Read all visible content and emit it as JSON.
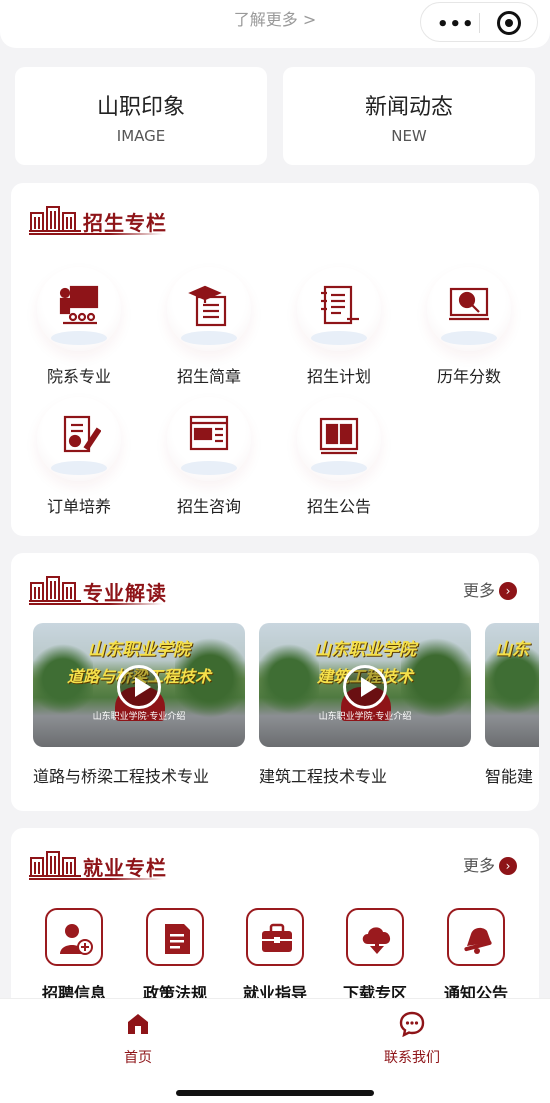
{
  "top": {
    "more_link": "了解更多 >"
  },
  "quick_cards": [
    {
      "title": "山职印象",
      "subtitle": "IMAGE"
    },
    {
      "title": "新闻动态",
      "subtitle": "NEW"
    }
  ],
  "admissions": {
    "title": "招生专栏",
    "items": [
      {
        "label": "院系专业",
        "icon": "department-icon"
      },
      {
        "label": "招生简章",
        "icon": "brochure-icon"
      },
      {
        "label": "招生计划",
        "icon": "plan-notebook-icon"
      },
      {
        "label": "历年分数",
        "icon": "score-search-icon"
      },
      {
        "label": "订单培养",
        "icon": "order-edit-icon"
      },
      {
        "label": "招生咨询",
        "icon": "consult-chat-icon"
      },
      {
        "label": "招生公告",
        "icon": "announcement-book-icon"
      }
    ]
  },
  "majors": {
    "title": "专业解读",
    "more": "更多",
    "videos": [
      {
        "title": "道路与桥梁工程技术专业",
        "caption1": "山东职业学院",
        "caption2": "道路与桥梁工程技术",
        "caption3": "山东职业学院·专业介绍"
      },
      {
        "title": "建筑工程技术专业",
        "caption1": "山东职业学院",
        "caption2": "建筑工程技术",
        "caption3": "山东职业学院·专业介绍"
      },
      {
        "title": "智能建",
        "caption1": "山东",
        "caption2": "",
        "caption3": ""
      }
    ]
  },
  "employment": {
    "title": "就业专栏",
    "more": "更多",
    "items": [
      {
        "label": "招聘信息",
        "icon": "add-user-icon"
      },
      {
        "label": "政策法规",
        "icon": "policy-doc-icon"
      },
      {
        "label": "就业指导",
        "icon": "briefcase-icon"
      },
      {
        "label": "下载专区",
        "icon": "download-cloud-icon"
      },
      {
        "label": "通知公告",
        "icon": "bell-icon"
      }
    ]
  },
  "tabbar": [
    {
      "label": "首页",
      "icon": "home-icon"
    },
    {
      "label": "联系我们",
      "icon": "chat-icon"
    }
  ],
  "colors": {
    "brand": "#8e1418",
    "background": "#f3f3f5"
  }
}
